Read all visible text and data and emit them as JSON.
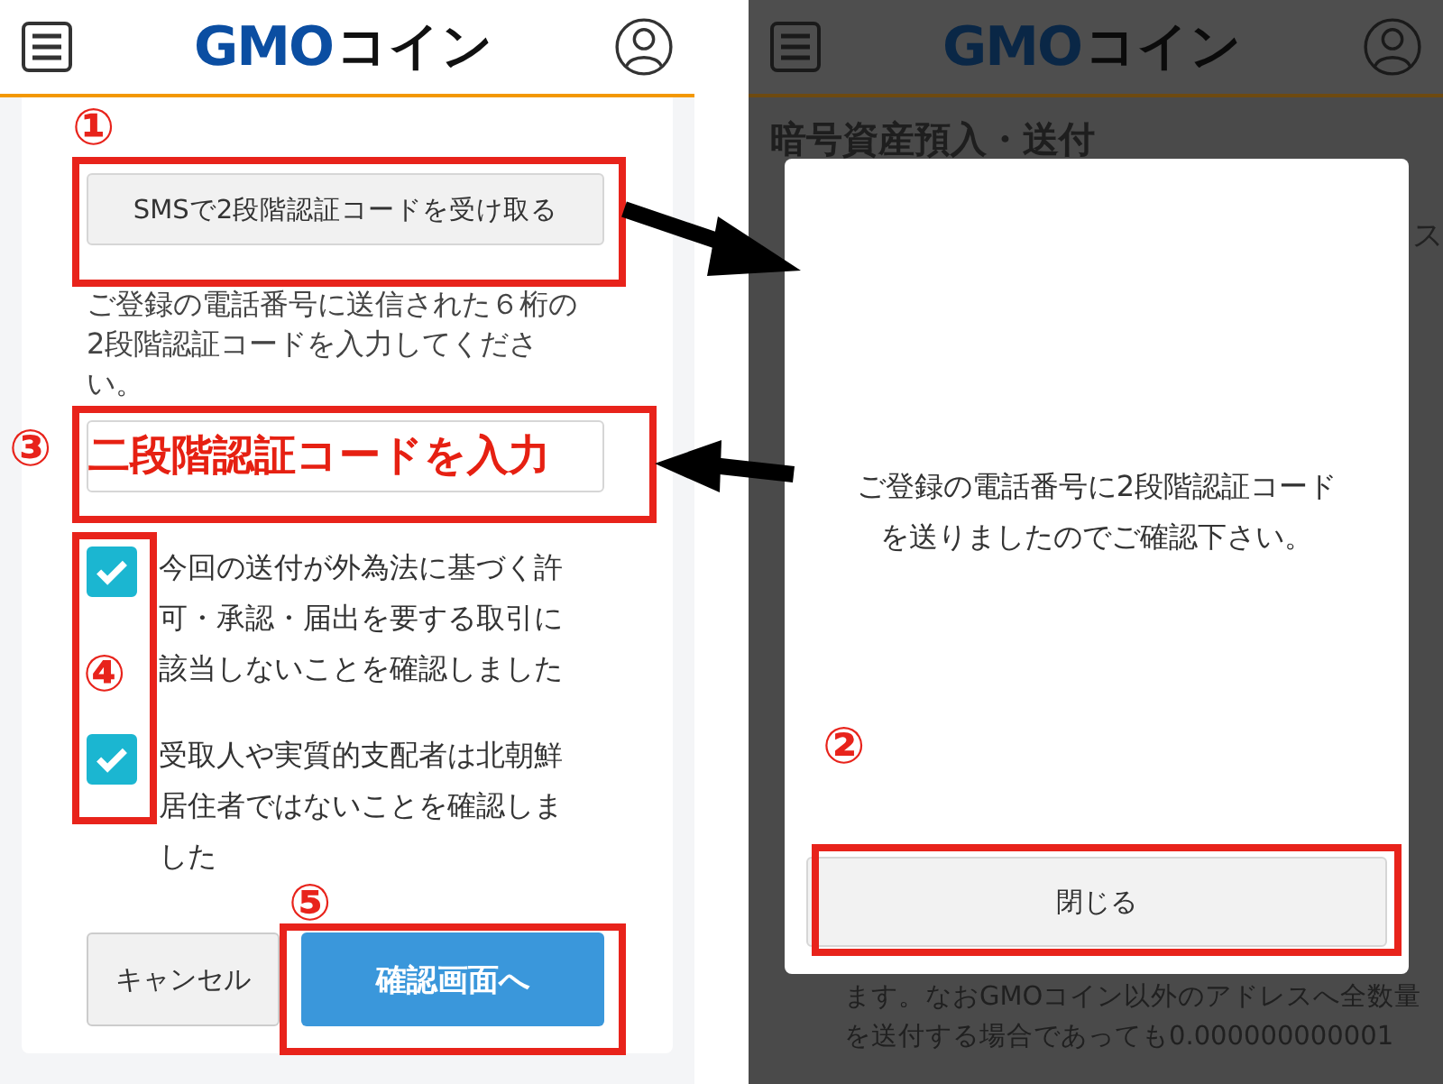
{
  "left_screen": {
    "header": {
      "logo_main": "GMO",
      "logo_sub": "コイン"
    },
    "sms_button": "SMSで2段階認証コードを受け取る",
    "instructions": "ご登録の電話番号に送信された６桁の2段階認証コードを入力してください。",
    "code_field_annotation": "二段階認証コードを入力",
    "checkboxes": [
      {
        "label": "今回の送付が外為法に基づく許可・承認・届出を要する取引に該当しないことを確認しました",
        "checked": true
      },
      {
        "label": "受取人や実質的支配者は北朝鮮居住者ではないことを確認しました",
        "checked": true
      }
    ],
    "cancel_button": "キャンセル",
    "confirm_button": "確認画面へ"
  },
  "right_screen": {
    "header": {
      "logo_main": "GMO",
      "logo_sub": "コイン"
    },
    "page_title": "暗号資産預入・送付",
    "side_text": "ス",
    "notice_lines": [
      "ます。なおGMOコイン以外のアドレスへ全数量",
      "を送付する場合であっても0.000000000001"
    ],
    "dialog": {
      "message": "ご登録の電話番号に2段階認証コードを送りましたのでご確認下さい。",
      "close_button": "閉じる"
    }
  },
  "annotations": {
    "markers": [
      {
        "label": "①"
      },
      {
        "label": "②"
      },
      {
        "label": "③"
      },
      {
        "label": "④"
      },
      {
        "label": "⑤"
      }
    ]
  }
}
